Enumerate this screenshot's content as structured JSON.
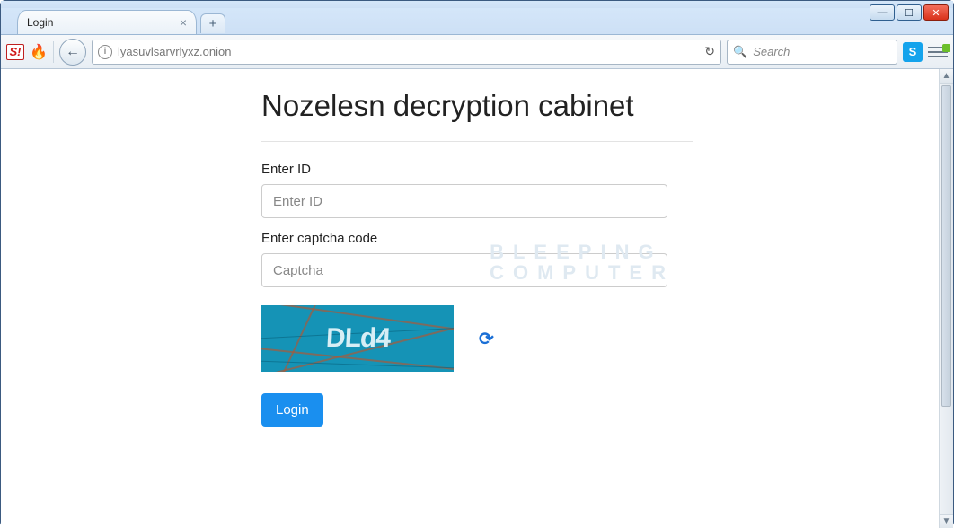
{
  "window": {
    "minimize_glyph": "—",
    "maximize_glyph": "☐",
    "close_glyph": "✕"
  },
  "browser": {
    "tab_title": "Login",
    "tab_close_glyph": "×",
    "newtab_glyph": "+",
    "back_glyph": "←",
    "url": "lyasuvlsarvrlyxz.onion",
    "info_glyph": "i",
    "reload_glyph": "↻",
    "search_placeholder": "Search",
    "ext_s_label": "S!",
    "ext_fire_glyph": "🔥",
    "ext_blue_label": "S",
    "search_icon_glyph": "🔍",
    "scroll_up_glyph": "▲",
    "scroll_down_glyph": "▼"
  },
  "page": {
    "title": "Nozelesn decryption cabinet",
    "id_label": "Enter ID",
    "id_placeholder": "Enter ID",
    "captcha_label": "Enter captcha code",
    "captcha_placeholder": "Captcha",
    "captcha_text": "DLd4",
    "refresh_glyph": "⟳",
    "login_label": "Login",
    "watermark_line1": "BLEEPING",
    "watermark_line2": "COMPUTER"
  }
}
